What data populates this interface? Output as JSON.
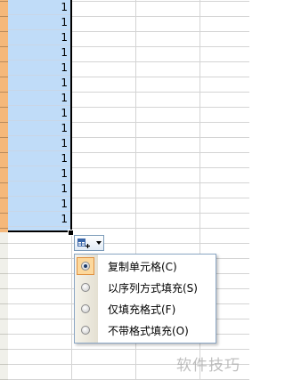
{
  "spreadsheet": {
    "filled_value": "1",
    "filled_rows": 15
  },
  "paste_options_button": {
    "icon": "paste-options-icon",
    "arrow_icon": "dropdown-arrow-icon"
  },
  "autofill_menu": {
    "items": [
      {
        "label": "复制单元格(C)",
        "checked": true
      },
      {
        "label": "以序列方式填充(S)",
        "checked": false
      },
      {
        "label": "仅填充格式(F)",
        "checked": false
      },
      {
        "label": "不带格式填充(O)",
        "checked": false
      }
    ]
  },
  "watermark": {
    "text": "软件技巧"
  },
  "colors": {
    "selection": "#c0dcf8",
    "row_header_highlight": "#f5b87a",
    "checked_item": "#fcd89c"
  }
}
